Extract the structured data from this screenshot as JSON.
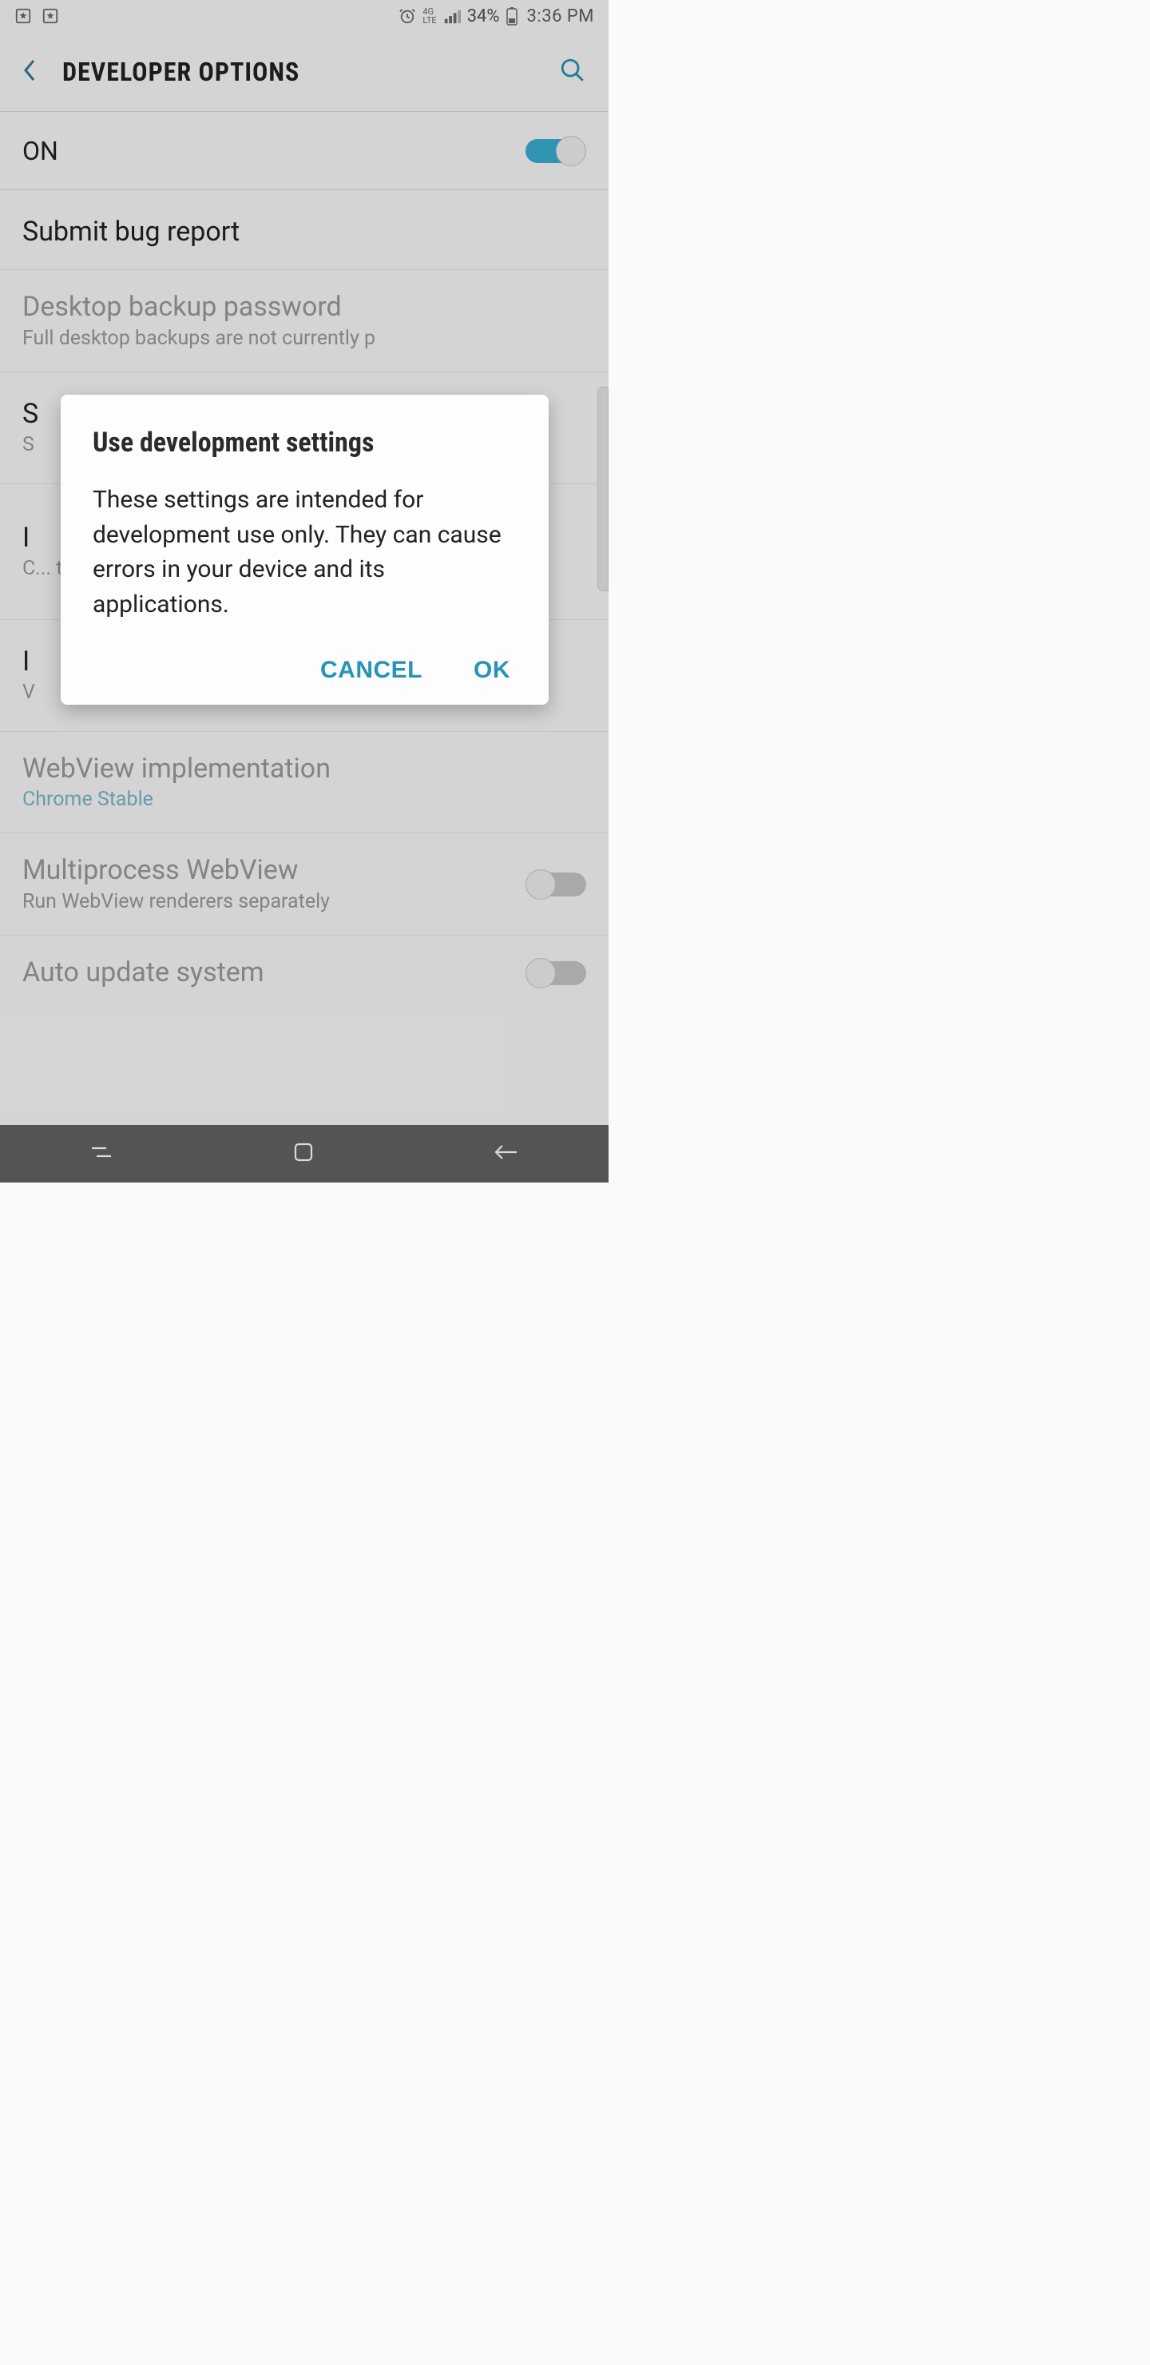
{
  "status": {
    "battery_text": "34%",
    "time": "3:36 PM"
  },
  "header": {
    "title": "DEVELOPER OPTIONS"
  },
  "master": {
    "label": "ON",
    "enabled": true
  },
  "settings": [
    {
      "title": "Submit bug report",
      "subtitle": "",
      "disabled": false,
      "switch": null
    },
    {
      "title": "Desktop backup password",
      "subtitle": "Full desktop backups are not currently p",
      "disabled": true,
      "switch": null
    },
    {
      "title": "S",
      "subtitle": "S",
      "disabled": false,
      "switch": null
    },
    {
      "title": "I",
      "subtitle": "C... t",
      "disabled": false,
      "switch": null
    },
    {
      "title": "I",
      "subtitle": "V",
      "disabled": false,
      "switch": null
    },
    {
      "title": "WebView implementation",
      "subtitle": "Chrome Stable",
      "subtitle_accent": true,
      "disabled": true,
      "switch": null
    },
    {
      "title": "Multiprocess WebView",
      "subtitle": "Run WebView renderers separately",
      "disabled": true,
      "switch": false
    },
    {
      "title": "Auto update system",
      "subtitle": "",
      "disabled": true,
      "switch": false
    }
  ],
  "dialog": {
    "title": "Use development settings",
    "body": "These settings are intended for development use only. They can cause errors in your device and its applications.",
    "cancel": "CANCEL",
    "ok": "OK"
  }
}
